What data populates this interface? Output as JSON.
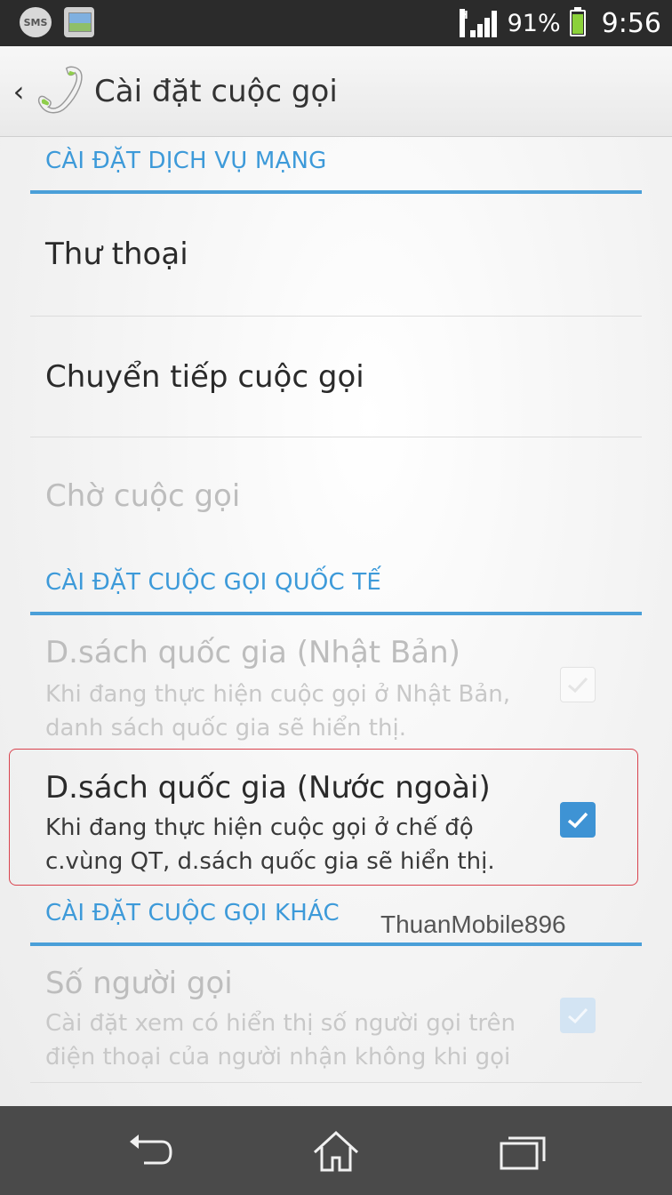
{
  "status_bar": {
    "network_type": "H",
    "battery_percent": "91%",
    "time": "9:56",
    "left_icons": [
      "sms-icon",
      "gallery-icon"
    ],
    "sms_label": "SMS"
  },
  "action_bar": {
    "title": "Cài đặt cuộc gọi",
    "back_icon": "chevron-left-icon",
    "app_icon": "phone-handset-icon"
  },
  "sections": {
    "network": {
      "header": "CÀI ĐẶT DỊCH VỤ MẠNG",
      "items": [
        {
          "title": "Thư thoại",
          "enabled": true
        },
        {
          "title": "Chuyển tiếp cuộc gọi",
          "enabled": true
        },
        {
          "title": "Chờ cuộc gọi",
          "enabled": false
        }
      ]
    },
    "international": {
      "header": "CÀI ĐẶT CUỘC GỌI QUỐC TẾ",
      "items": [
        {
          "title": "D.sách quốc gia (Nhật Bản)",
          "subtitle": "Khi đang thực hiện cuộc gọi ở Nhật Bản, danh sách quốc gia sẽ hiển thị.",
          "enabled": false,
          "checked": true
        },
        {
          "title": "D.sách quốc gia (Nước ngoài)",
          "subtitle": "Khi đang thực hiện cuộc gọi ở chế độ c.vùng QT, d.sách quốc gia sẽ hiển thị.",
          "enabled": true,
          "checked": true
        }
      ]
    },
    "other": {
      "header": "CÀI ĐẶT CUỘC GỌI KHÁC",
      "items": [
        {
          "title": "Số người gọi",
          "subtitle": "Cài đặt xem có hiển thị số người gọi trên điện thoại của người nhận không khi gọi",
          "enabled": false,
          "checked": true
        }
      ]
    }
  },
  "watermark": "ThuanMobile896",
  "nav_bar": {
    "buttons": [
      "back-icon",
      "home-icon",
      "recent-apps-icon"
    ]
  },
  "colors": {
    "accent": "#3d9ad9",
    "highlight": "#d9434e",
    "status_bar_bg": "#2b2b2b",
    "nav_bar_bg": "#4a4a4a"
  }
}
